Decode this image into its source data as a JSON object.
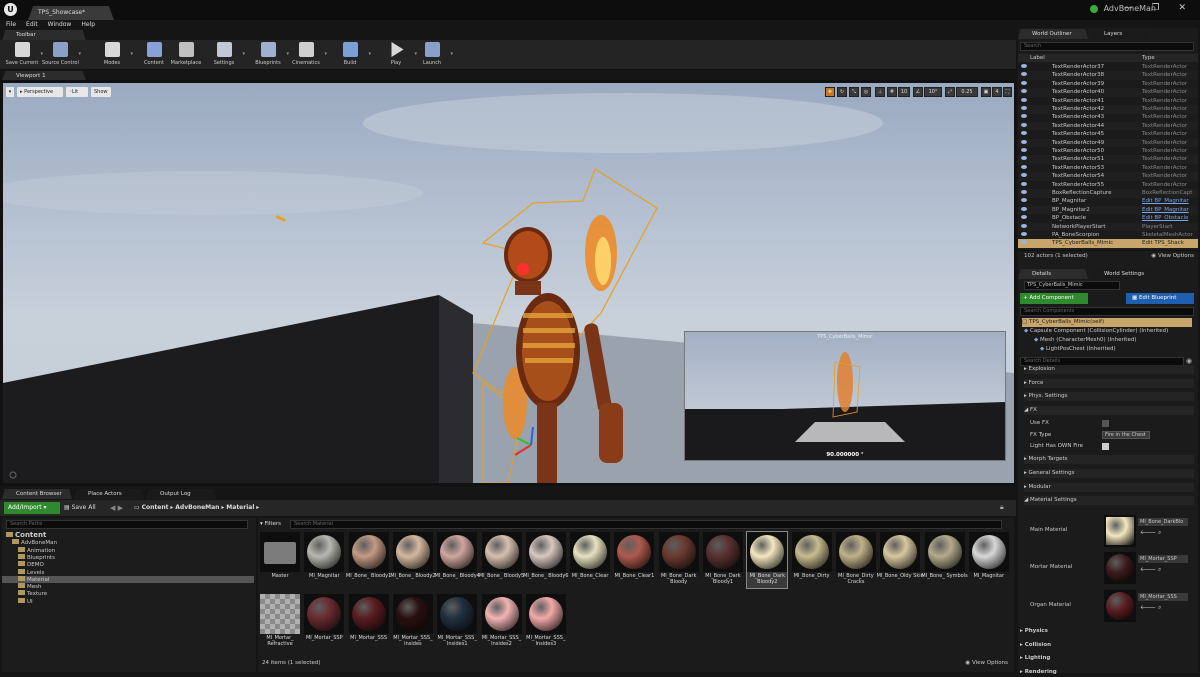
{
  "window": {
    "doc_tab": "TPS_Showcase*",
    "project_name": "AdvBoneMan",
    "window_buttons": "— ❐ ✕"
  },
  "menu": [
    "File",
    "Edit",
    "Window",
    "Help"
  ],
  "tabs": {
    "toolbar": "Toolbar",
    "viewport": "Viewport 1",
    "content_browser": "Content Browser",
    "place_actors": "Place Actors",
    "output_log": "Output Log",
    "world_outliner": "World Outliner",
    "layers": "Layers",
    "details": "Details",
    "world_settings": "World Settings"
  },
  "toolbar": [
    {
      "label": "Save Current",
      "icon": "save-icon"
    },
    {
      "label": "Source Control",
      "icon": "source-control-icon"
    },
    {
      "label": "Modes",
      "icon": "modes-icon"
    },
    {
      "label": "Content",
      "icon": "content-icon"
    },
    {
      "label": "Marketplace",
      "icon": "marketplace-icon"
    },
    {
      "label": "Settings",
      "icon": "settings-icon"
    },
    {
      "label": "Blueprints",
      "icon": "blueprints-icon"
    },
    {
      "label": "Cinematics",
      "icon": "cinematics-icon"
    },
    {
      "label": "Build",
      "icon": "build-icon"
    },
    {
      "label": "Play",
      "icon": "play-icon"
    },
    {
      "label": "Launch",
      "icon": "launch-icon"
    }
  ],
  "viewport": {
    "perspective": "Perspective",
    "lit": "Lit",
    "show": "Show",
    "grid_snap": "10",
    "rotation_snap": "10°",
    "scale_snap": "0.25",
    "camera_speed": "4",
    "preview_title": "TPS_CyberBalls_Mimic",
    "preview_value": "90.000000 °"
  },
  "content_browser": {
    "add_import": "Add/Import",
    "save_all": "Save All",
    "path": [
      "Content",
      "AdvBoneMan",
      "Material"
    ],
    "search_paths_placeholder": "Search Paths",
    "filters": "Filters",
    "search_material_placeholder": "Search Material",
    "status": "24 items (1 selected)",
    "view_options": "View Options",
    "tree": [
      {
        "label": "Content",
        "depth": 0
      },
      {
        "label": "AdvBoneMan",
        "depth": 1
      },
      {
        "label": "Animation",
        "depth": 2
      },
      {
        "label": "Blueprints",
        "depth": 2
      },
      {
        "label": "DEMO",
        "depth": 2
      },
      {
        "label": "Levels",
        "depth": 2
      },
      {
        "label": "Material",
        "depth": 2
      },
      {
        "label": "Mesh",
        "depth": 2
      },
      {
        "label": "Texture",
        "depth": 2
      },
      {
        "label": "UI",
        "depth": 2
      }
    ],
    "assets_row1": [
      {
        "label": "Master",
        "color": "#7b7b7b"
      },
      {
        "label": "MI_Magnitar",
        "color": "#b8b8b0"
      },
      {
        "label": "MI_Bone_ Bloody1",
        "color": "#c49a84"
      },
      {
        "label": "MI_Bone_ Bloody2",
        "color": "#d6b9a0"
      },
      {
        "label": "MI_Bone_ Bloody4",
        "color": "#d0a6a0"
      },
      {
        "label": "MI_Bone_ Bloody5",
        "color": "#d8c0b0"
      },
      {
        "label": "MI_Bone_ Bloody6",
        "color": "#d8c8c0"
      },
      {
        "label": "MI_Bone_Clear",
        "color": "#e8e2c0"
      },
      {
        "label": "MI_Bone_Clear1",
        "color": "#b05a4e"
      },
      {
        "label": "MI_Bone_Dark Bloody",
        "color": "#6a3a30"
      },
      {
        "label": "MI_Bone_Dark Bloody1",
        "color": "#5a3030"
      },
      {
        "label": "MI_Bone_Dark Bloody2",
        "color": "#f4e8c0"
      },
      {
        "label": "MI_Bone_Dirty",
        "color": "#c8bb90"
      },
      {
        "label": "MI_Bone_Dirty Cracks",
        "color": "#c0b288"
      },
      {
        "label": "MI_Bone_Oldy Skin",
        "color": "#d8c8a0"
      },
      {
        "label": "MI_Bone_ Symbols",
        "color": "#b4aa8c"
      },
      {
        "label": "MI_Magnitar",
        "color": "#d8d8d8"
      }
    ],
    "assets_row2": [
      {
        "label": "MI_Mortar_ Refractive",
        "color": "#9a9a9a"
      },
      {
        "label": "MI_Mortar_SSP",
        "color": "#6a2a30"
      },
      {
        "label": "MI_Mortar_SSS",
        "color": "#5a1c20"
      },
      {
        "label": "MI_Mortar_SSS_ Insides",
        "color": "#2a1010"
      },
      {
        "label": "MI_Mortar_SSS_ Insides1",
        "color": "#203040"
      },
      {
        "label": "MI_Mortar_SSS_ Insides2",
        "color": "#f2b4b4"
      },
      {
        "label": "MI_Mortar_SSS_ Insides3",
        "color": "#f2aaa8"
      }
    ]
  },
  "outliner": {
    "search_placeholder": "Search",
    "col_label": "Label",
    "col_type": "Type",
    "rows": [
      {
        "label": "TextRenderActor37",
        "type": "TextRenderActor"
      },
      {
        "label": "TextRenderActor38",
        "type": "TextRenderActor"
      },
      {
        "label": "TextRenderActor39",
        "type": "TextRenderActor"
      },
      {
        "label": "TextRenderActor40",
        "type": "TextRenderActor"
      },
      {
        "label": "TextRenderActor41",
        "type": "TextRenderActor"
      },
      {
        "label": "TextRenderActor42",
        "type": "TextRenderActor"
      },
      {
        "label": "TextRenderActor43",
        "type": "TextRenderActor"
      },
      {
        "label": "TextRenderActor44",
        "type": "TextRenderActor"
      },
      {
        "label": "TextRenderActor45",
        "type": "TextRenderActor"
      },
      {
        "label": "TextRenderActor49",
        "type": "TextRenderActor"
      },
      {
        "label": "TextRenderActor50",
        "type": "TextRenderActor"
      },
      {
        "label": "TextRenderActor51",
        "type": "TextRenderActor"
      },
      {
        "label": "TextRenderActor53",
        "type": "TextRenderActor"
      },
      {
        "label": "TextRenderActor54",
        "type": "TextRenderActor"
      },
      {
        "label": "TextRenderActor55",
        "type": "TextRenderActor"
      },
      {
        "label": "BoxReflectionCapture",
        "type": "BoxReflectionCapt"
      },
      {
        "label": "BP_Magnitar",
        "type": "Edit BP_Magnitar"
      },
      {
        "label": "BP_Magnitar2",
        "type": "Edit BP_Magnitar"
      },
      {
        "label": "BP_Obstacle",
        "type": "Edit BP_Obstacle"
      },
      {
        "label": "NetworkPlayerStart",
        "type": "PlayerStart"
      },
      {
        "label": "PA_BoneScorpion",
        "type": "SkeletalMeshActor"
      },
      {
        "label": "TPS_CyberBalls_Mimic",
        "type": "Edit TPS_Shack"
      }
    ],
    "status": "102 actors (1 selected)",
    "view_options": "View Options"
  },
  "details": {
    "actor_name": "TPS_CyberBalls_Mimic",
    "add_component": "+ Add Component",
    "edit_blueprint": "Edit Blueprint",
    "search_components": "Search Components",
    "components": [
      "TPS_CyberBalls_Mimic(self)",
      "Capsule Component (CollisionCylinder) (Inherited)",
      "Mesh (CharacterMesh0) (Inherited)",
      "LightPosChest (Inherited)"
    ],
    "search_details": "Search Details",
    "categories": [
      "Explosion",
      "Force",
      "Phys. Settings",
      "FX"
    ],
    "use_fx": "Use FX",
    "fx_type": "FX Type",
    "fx_type_value": "Fire in the Chest",
    "light_has_own_fire": "Light Has OWN Fire",
    "more_categories": [
      "Morph Targets",
      "General Settings",
      "Modular",
      "Material Settings"
    ],
    "materials": [
      {
        "label": "Main Material",
        "value": "MI_Bone_DarkBlo",
        "color": "#f4e8c0"
      },
      {
        "label": "Mortar Material",
        "value": "MI_Mortar_SSP",
        "color": "#3a1a1c"
      },
      {
        "label": "Organ Material",
        "value": "MI_Mortar_SSS",
        "color": "#5a1c20"
      }
    ],
    "bottom_categories": [
      "Physics",
      "Collision",
      "Lighting",
      "Rendering"
    ]
  }
}
